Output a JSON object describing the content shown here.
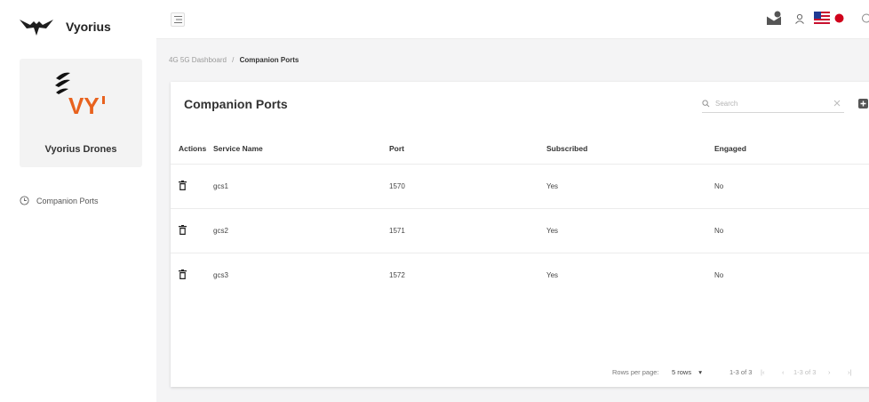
{
  "app": {
    "brand_name": "Vyorius"
  },
  "profile": {
    "name": "Vyorius Drones",
    "logo_text": "VY"
  },
  "sidebar": {
    "items": [
      {
        "label": "Companion Ports",
        "icon": "clock-icon"
      }
    ]
  },
  "topbar": {
    "icons": [
      "menu-icon",
      "mail-badge-icon",
      "user-icon",
      "us-flag-icon",
      "japan-flag-icon"
    ]
  },
  "breadcrumb": {
    "parent": "4G 5G Dashboard",
    "separator": "/",
    "current": "Companion Ports"
  },
  "card": {
    "title": "Companion Ports",
    "search": {
      "placeholder": "Search",
      "value": ""
    }
  },
  "table": {
    "headers": [
      "Actions",
      "Service Name",
      "Port",
      "Subscribed",
      "Engaged"
    ],
    "rows": [
      {
        "service": "gcs1",
        "port": "1570",
        "subscribed": "Yes",
        "engaged": "No"
      },
      {
        "service": "gcs2",
        "port": "1571",
        "subscribed": "Yes",
        "engaged": "No"
      },
      {
        "service": "gcs3",
        "port": "1572",
        "subscribed": "Yes",
        "engaged": "No"
      }
    ]
  },
  "pagination": {
    "rows_per_page_label": "Rows per page:",
    "rows_value": "5 rows",
    "range_text": "1-3 of 3",
    "range_text_inner": "1-3 of 3"
  },
  "colors": {
    "accent_orange": "#e8621e",
    "sidebar_bg": "#ffffff",
    "page_bg": "#f4f4f5"
  }
}
